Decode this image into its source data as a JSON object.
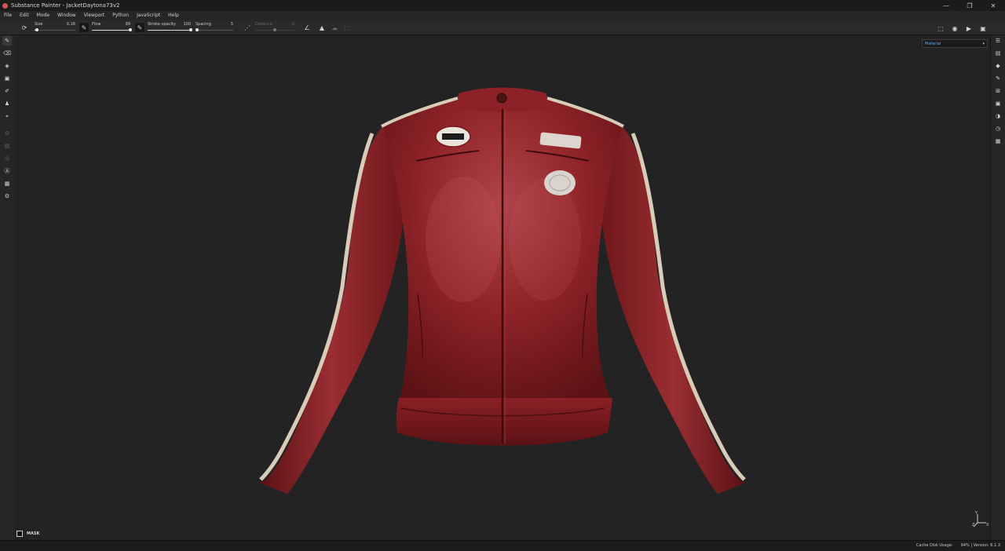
{
  "window": {
    "title": "Substance Painter - JacketDaytona73v2",
    "minimize": "—",
    "restore": "❐",
    "close": "✕"
  },
  "menu": [
    "File",
    "Edit",
    "Mode",
    "Window",
    "Viewport",
    "Python",
    "JavaScript",
    "Help"
  ],
  "toolbar": {
    "size_label": "Size",
    "size_value": "0.16",
    "size_fraction": 0.05,
    "flow_label": "Flow",
    "flow_value": "99",
    "flow_fraction": 0.99,
    "stroke_label": "Stroke opacity",
    "stroke_value": "100",
    "stroke_fraction": 1.0,
    "spacing_label": "Spacing",
    "spacing_value": "5",
    "spacing_fraction": 0.05,
    "distance_label": "Distance",
    "distance_value": "0",
    "distance_fraction": 0.5
  },
  "viewport": {
    "mode_value": "Material",
    "mask_label": "MASK",
    "axis_y": "Y",
    "axis_x": "X",
    "axis_z": "Z"
  },
  "status": {
    "cache": "Cache Disk Usage:",
    "version": "94% | Version: 6.1.3"
  },
  "colors": {
    "leather": "#8a1f24",
    "leather_highlight": "#b2484b",
    "stripe": "#d8ccb8",
    "accent": "#5fa8ff"
  }
}
